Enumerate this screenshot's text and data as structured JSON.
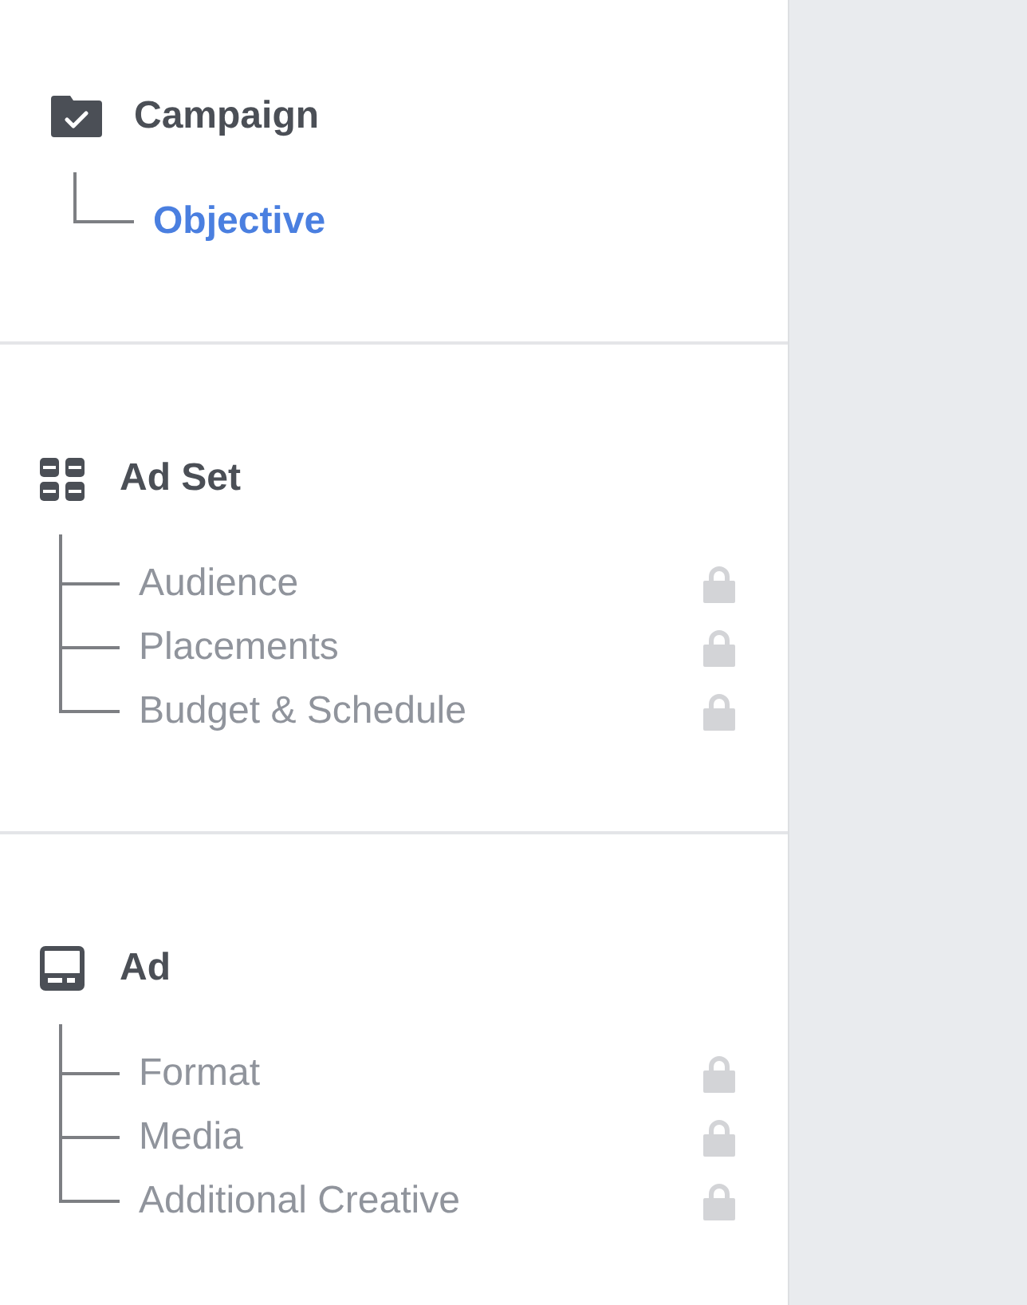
{
  "sections": [
    {
      "kind": "campaign",
      "title": "Campaign",
      "items": [
        {
          "label": "Objective",
          "selected": true,
          "locked": false
        }
      ]
    },
    {
      "kind": "ad_set",
      "title": "Ad Set",
      "items": [
        {
          "label": "Audience",
          "selected": false,
          "locked": true
        },
        {
          "label": "Placements",
          "selected": false,
          "locked": true
        },
        {
          "label": "Budget & Schedule",
          "selected": false,
          "locked": true
        }
      ]
    },
    {
      "kind": "ad",
      "title": "Ad",
      "items": [
        {
          "label": "Format",
          "selected": false,
          "locked": true
        },
        {
          "label": "Media",
          "selected": false,
          "locked": true
        },
        {
          "label": "Additional Creative",
          "selected": false,
          "locked": true
        }
      ]
    }
  ]
}
